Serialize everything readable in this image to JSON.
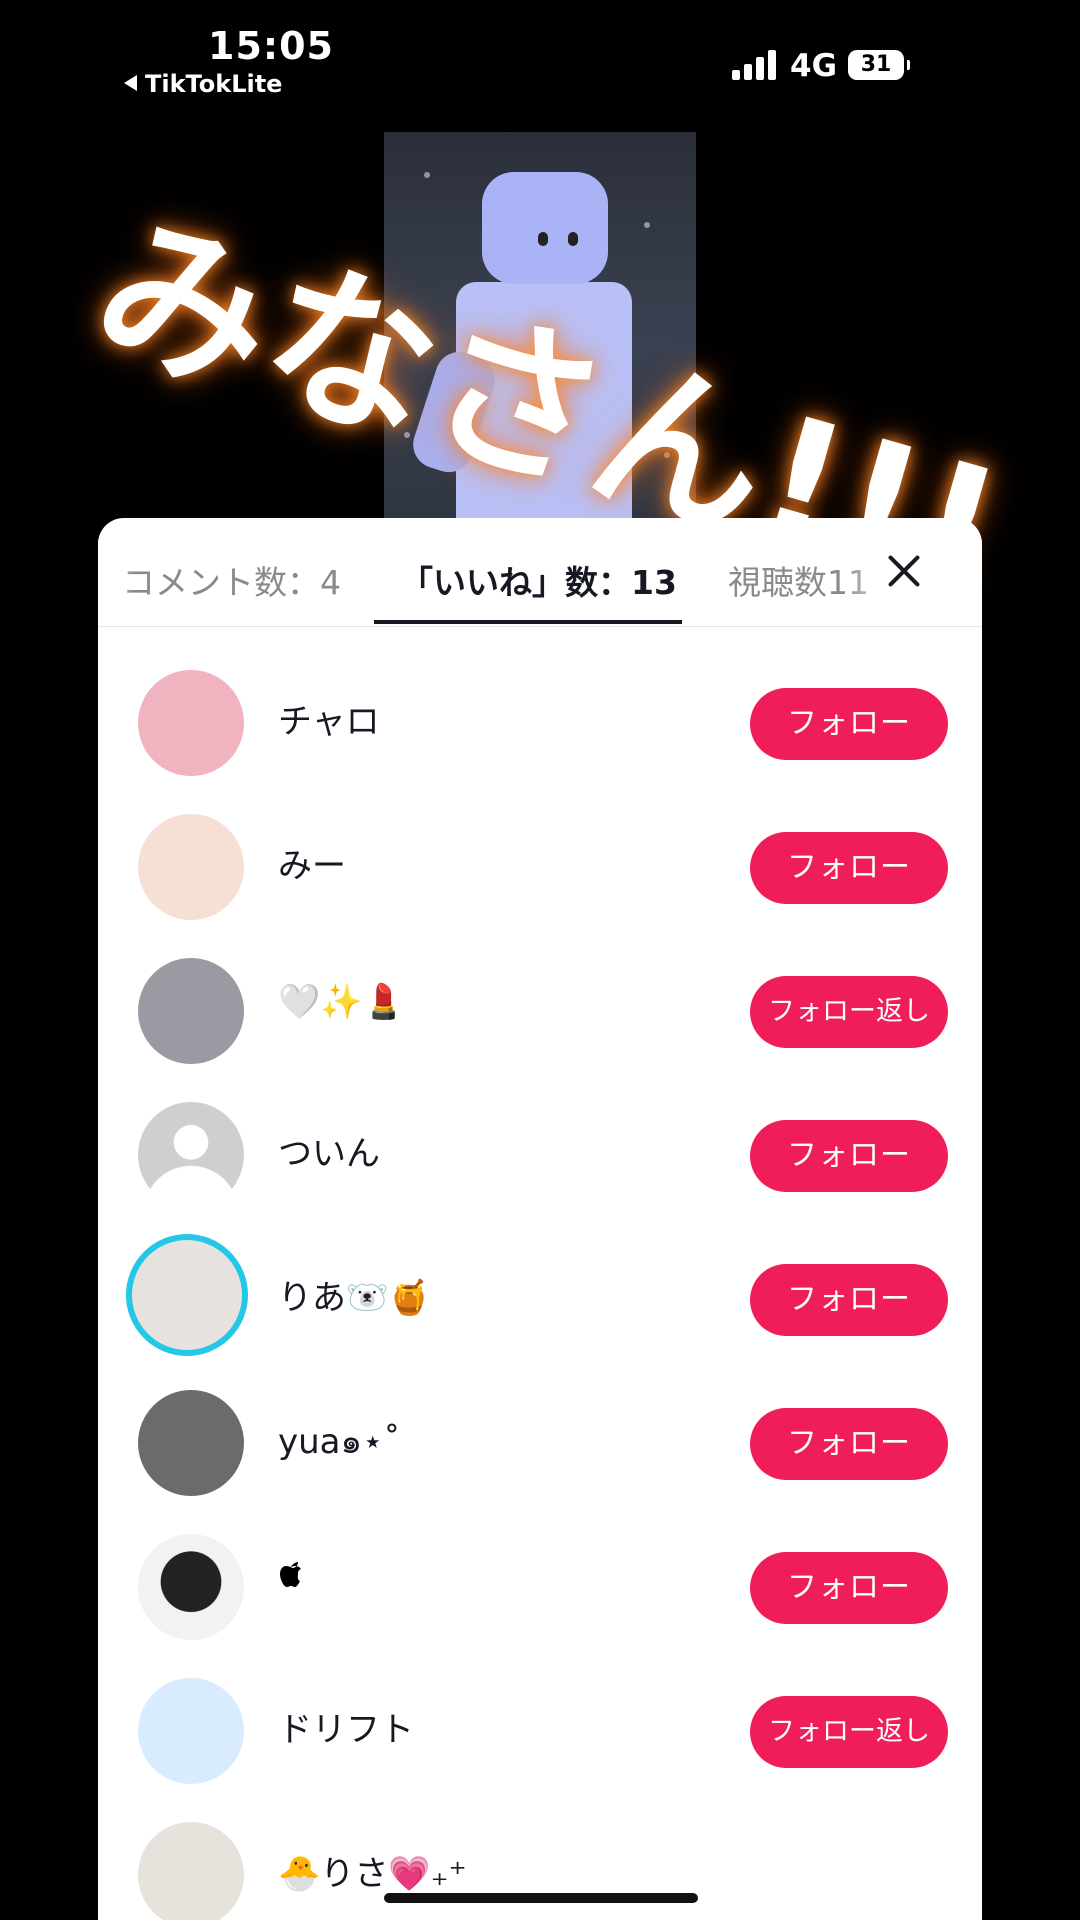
{
  "status_bar": {
    "time": "15:05",
    "back_app": "TikTokLite",
    "network": "4G",
    "battery": "31"
  },
  "video": {
    "overlay_text": "みなさん!!!"
  },
  "sheet": {
    "tabs": [
      {
        "label": "コメント数：4"
      },
      {
        "label": "「いいね」数：13"
      },
      {
        "label": "視聴数11"
      }
    ],
    "active_tab": 1,
    "users": [
      {
        "name": "チャロ",
        "button": "フォロー",
        "avatar_color": "#f0b3c0"
      },
      {
        "name": "みー",
        "button": "フォロー",
        "avatar_color": "#f6e0d5"
      },
      {
        "name": "🤍✨💄",
        "button": "フォロー返し",
        "avatar_color": "#9a9aa2"
      },
      {
        "name": "ついん",
        "button": "フォロー",
        "avatar_color": "#cfcfcf"
      },
      {
        "name": "りあ🐻‍❄️🍯",
        "button": "フォロー",
        "avatar_color": "#e8e2de"
      },
      {
        "name": "yua๑⋆˚",
        "button": "フォロー",
        "avatar_color": "#6b6b6b"
      },
      {
        "name": "",
        "button": "フォロー",
        "avatar_color": "#e9e9e9"
      },
      {
        "name": "ドリフト",
        "button": "フォロー返し",
        "avatar_color": "#d9ecff"
      },
      {
        "name": "🐣りさ💗₊⁺",
        "button": "",
        "avatar_color": "#e7e2dc"
      }
    ]
  },
  "colors": {
    "follow_button": "#ef1e5a",
    "story_ring": "#23c7e8"
  }
}
